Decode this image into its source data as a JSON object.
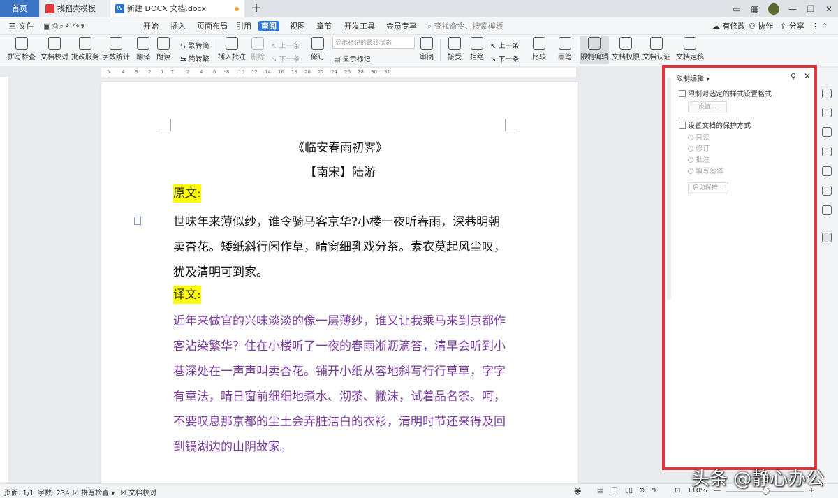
{
  "titlebar": {
    "home_tab": "首页",
    "tabs": [
      {
        "label": "找稻壳模板"
      },
      {
        "label": "新建 DOCX 文档.docx"
      }
    ]
  },
  "menubar": {
    "file": "三 文件",
    "items": [
      "开始",
      "插入",
      "页面布局",
      "引用",
      "审阅",
      "视图",
      "章节",
      "开发工具",
      "会员专享"
    ],
    "active": "审阅",
    "search_placeholder": "查找命令、搜索模板",
    "has_changes": "有修改",
    "collab": "协作",
    "share": "分享"
  },
  "ribbon": {
    "spell": "拼写检查",
    "proofread": "文档校对",
    "batch": "批改服务",
    "wordcount": "字数统计",
    "translate": "翻译",
    "read": "朗读",
    "t2s": "繁转简",
    "s2t": "简转繁",
    "insert_comment": "插入批注",
    "delete": "删除",
    "prev1": "上一条",
    "next1": "下一条",
    "revise": "修订",
    "show_state": "显示标记的最终状态",
    "show_marks": "显示标记",
    "review": "审阅",
    "accept": "接受",
    "reject": "拒绝",
    "prev2": "上一条",
    "next2": "下一条",
    "compare": "比较",
    "pen": "画笔",
    "restrict": "限制编辑",
    "perm": "文档权限",
    "cert": "文档认证",
    "final": "文档定稿"
  },
  "ruler": [
    "5",
    "4",
    "3",
    "2",
    "1",
    "",
    "2",
    "4",
    "6",
    "8",
    "10",
    "12",
    "14",
    "16",
    "18",
    "20",
    "22",
    "24",
    "26",
    "28",
    "30",
    "31"
  ],
  "document": {
    "title": "《临安春雨初霁》",
    "author": "【南宋】陆游",
    "label_original": "原文:",
    "original": "世味年来薄似纱，谁令骑马客京华?小楼一夜听春雨，深巷明朝卖杏花。矮纸斜行闲作草，晴窗细乳戏分茶。素衣莫起风尘叹，犹及清明可到家。",
    "label_translation": "译文:",
    "translation": "近年来做官的兴味淡淡的像一层薄纱，谁又让我乘马来到京都作客沾染繁华？住在小楼听了一夜的春雨淅沥滴答，清早会听到小巷深处在一声声叫卖杏花。铺开小纸从容地斜写行行草草，字字有章法，晴日窗前细细地煮水、沏茶、撇沫，试着品名茶。呵，不要叹息那京都的尘土会弄脏洁白的衣衫，清明时节还来得及回到镜湖边的山阴故家。"
  },
  "panel": {
    "title": "限制编辑",
    "opt1": "限制对选定的样式设置格式",
    "settings_btn": "设置...",
    "opt2": "设置文档的保护方式",
    "radios": [
      "只读",
      "修订",
      "批注",
      "填写窗体"
    ],
    "start_btn": "启动保护..."
  },
  "statusbar": {
    "page": "页面: 1/1",
    "words": "字数: 234",
    "spell": "拼写检查",
    "proof": "文档校对",
    "zoom": "110%"
  },
  "watermark": "头条 @静心办公"
}
